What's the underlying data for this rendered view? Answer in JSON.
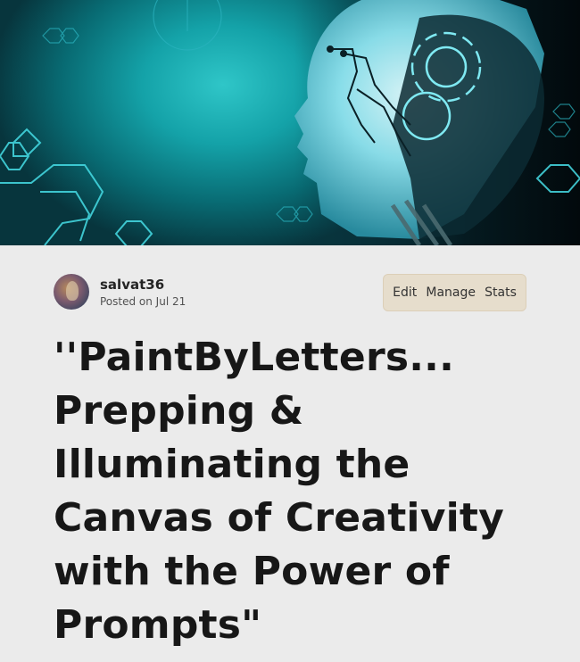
{
  "cover": {
    "icon": "ai-robot-head-illustration"
  },
  "author": {
    "username": "salvat36",
    "posted": "Posted on Jul 21"
  },
  "actions": {
    "edit": "Edit",
    "manage": "Manage",
    "stats": "Stats"
  },
  "article": {
    "title": "''PaintByLetters... Prepping & Illuminating the Canvas of Creativity with the Power of Prompts\""
  },
  "colors": {
    "background": "#ebebeb",
    "actions_bg": "#e6ddcc",
    "cover_accent": "#2fc6c8"
  }
}
